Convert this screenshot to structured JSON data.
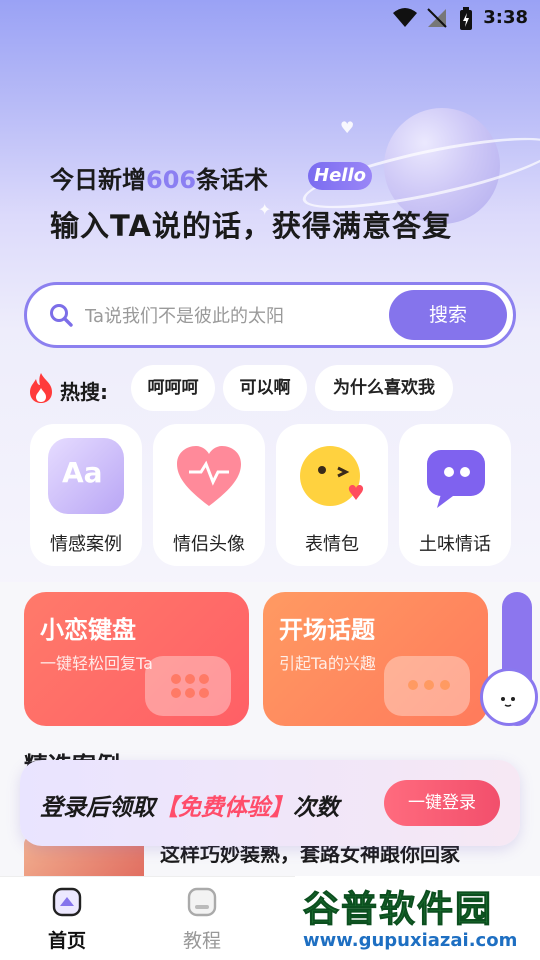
{
  "status_bar": {
    "time": "3:38"
  },
  "header": {
    "title_prefix": "今日新增",
    "title_count": "606",
    "title_suffix": "条话术",
    "hello_badge": "Hello",
    "subtitle": "输入TA说的话，获得满意答复"
  },
  "search": {
    "placeholder": "Ta说我们不是彼此的太阳",
    "button_label": "搜索"
  },
  "hot_search": {
    "label": "热搜:",
    "chips": [
      "呵呵呵",
      "可以啊",
      "为什么喜欢我"
    ]
  },
  "categories": [
    {
      "label": "情感案例",
      "icon": "aa-icon"
    },
    {
      "label": "情侣头像",
      "icon": "heart-icon"
    },
    {
      "label": "表情包",
      "icon": "emoji-icon"
    },
    {
      "label": "土味情话",
      "icon": "chat-bubble-icon"
    }
  ],
  "cards": [
    {
      "title": "小恋键盘",
      "subtitle": "一键轻松回复Ta",
      "color": "#ff6b6b"
    },
    {
      "title": "开场话题",
      "subtitle": "引起Ta的兴趣",
      "color": "#ff8a5c"
    }
  ],
  "featured": {
    "section_title": "精选案例",
    "case_title": "这样巧妙装熟，套路女神跟你回家"
  },
  "login_banner": {
    "text_prefix": "登录后领取",
    "text_highlight": "【免费体验】",
    "text_suffix": "次数",
    "button_label": "一键登录"
  },
  "tabbar": {
    "items": [
      {
        "label": "首页",
        "active": true
      },
      {
        "label": "教程",
        "active": false
      }
    ]
  },
  "watermark": {
    "name": "谷普软件园",
    "url": "www.gupuxiazai.com"
  },
  "colors": {
    "accent": "#8574ec",
    "hot": "#ff4d4d"
  }
}
